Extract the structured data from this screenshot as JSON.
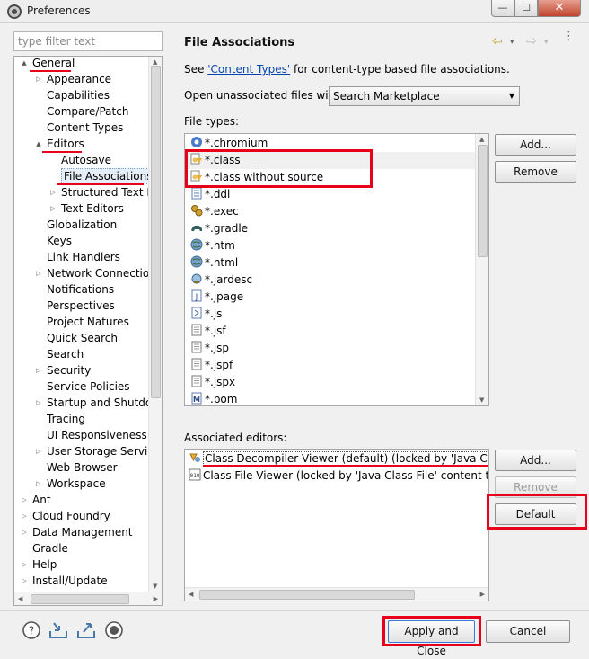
{
  "window": {
    "title": "Preferences",
    "min_glyph": "—",
    "max_glyph": "☐",
    "close_glyph": "✕"
  },
  "filter": {
    "placeholder": "type filter text"
  },
  "tree": {
    "items": [
      {
        "label": "General",
        "level": 0,
        "twisty": "▲"
      },
      {
        "label": "Appearance",
        "level": 1,
        "twisty": "▷"
      },
      {
        "label": "Capabilities",
        "level": 1,
        "twisty": ""
      },
      {
        "label": "Compare/Patch",
        "level": 1,
        "twisty": ""
      },
      {
        "label": "Content Types",
        "level": 1,
        "twisty": ""
      },
      {
        "label": "Editors",
        "level": 1,
        "twisty": "▲"
      },
      {
        "label": "Autosave",
        "level": 2,
        "twisty": ""
      },
      {
        "label": "File Associations",
        "level": 2,
        "twisty": "",
        "selected": true
      },
      {
        "label": "Structured Text Ec",
        "level": 2,
        "twisty": "▷"
      },
      {
        "label": "Text Editors",
        "level": 2,
        "twisty": "▷"
      },
      {
        "label": "Globalization",
        "level": 1,
        "twisty": ""
      },
      {
        "label": "Keys",
        "level": 1,
        "twisty": ""
      },
      {
        "label": "Link Handlers",
        "level": 1,
        "twisty": ""
      },
      {
        "label": "Network Connection",
        "level": 1,
        "twisty": "▷"
      },
      {
        "label": "Notifications",
        "level": 1,
        "twisty": ""
      },
      {
        "label": "Perspectives",
        "level": 1,
        "twisty": ""
      },
      {
        "label": "Project Natures",
        "level": 1,
        "twisty": ""
      },
      {
        "label": "Quick Search",
        "level": 1,
        "twisty": ""
      },
      {
        "label": "Search",
        "level": 1,
        "twisty": ""
      },
      {
        "label": "Security",
        "level": 1,
        "twisty": "▷"
      },
      {
        "label": "Service Policies",
        "level": 1,
        "twisty": ""
      },
      {
        "label": "Startup and Shutdow",
        "level": 1,
        "twisty": "▷"
      },
      {
        "label": "Tracing",
        "level": 1,
        "twisty": ""
      },
      {
        "label": "UI Responsiveness M",
        "level": 1,
        "twisty": ""
      },
      {
        "label": "User Storage Service",
        "level": 1,
        "twisty": "▷"
      },
      {
        "label": "Web Browser",
        "level": 1,
        "twisty": ""
      },
      {
        "label": "Workspace",
        "level": 1,
        "twisty": "▷"
      },
      {
        "label": "Ant",
        "level": 0,
        "twisty": "▷"
      },
      {
        "label": "Cloud Foundry",
        "level": 0,
        "twisty": "▷"
      },
      {
        "label": "Data Management",
        "level": 0,
        "twisty": "▷"
      },
      {
        "label": "Gradle",
        "level": 0,
        "twisty": ""
      },
      {
        "label": "Help",
        "level": 0,
        "twisty": "▷"
      },
      {
        "label": "Install/Update",
        "level": 0,
        "twisty": "▷"
      }
    ]
  },
  "main": {
    "title": "File Associations",
    "see_prefix": "See ",
    "see_link": "'Content Types'",
    "see_suffix": " for content-type based file associations.",
    "open_label": "Open unassociated files with:",
    "open_value": "Search Marketplace",
    "filetypes_label": "File types:",
    "filetypes": [
      {
        "name": "*.chromium",
        "icon": "chromium-icon"
      },
      {
        "name": "*.class",
        "icon": "class-file-icon"
      },
      {
        "name": "*.class without source",
        "icon": "class-file-icon"
      },
      {
        "name": "*.ddl",
        "icon": "ddl-icon"
      },
      {
        "name": "*.exec",
        "icon": "exec-icon"
      },
      {
        "name": "*.gradle",
        "icon": "gradle-icon"
      },
      {
        "name": "*.htm",
        "icon": "globe-icon"
      },
      {
        "name": "*.html",
        "icon": "globe-icon"
      },
      {
        "name": "*.jardesc",
        "icon": "jardesc-icon"
      },
      {
        "name": "*.jpage",
        "icon": "jpage-icon"
      },
      {
        "name": "*.js",
        "icon": "js-icon"
      },
      {
        "name": "*.jsf",
        "icon": "text-file-icon"
      },
      {
        "name": "*.jsp",
        "icon": "text-file-icon"
      },
      {
        "name": "*.jspf",
        "icon": "text-file-icon"
      },
      {
        "name": "*.jspx",
        "icon": "text-file-icon"
      },
      {
        "name": "*.pom",
        "icon": "maven-icon"
      }
    ],
    "ft_add": "Add...",
    "ft_remove": "Remove",
    "assoc_label": "Associated editors:",
    "editors": [
      {
        "name": "Class Decompiler Viewer (default) (locked by 'Java Class File' content type)",
        "icon": "decompiler-icon"
      },
      {
        "name": "Class File Viewer (locked by 'Java Class File' content type)",
        "icon": "binary-file-icon"
      }
    ],
    "ed_add": "Add...",
    "ed_remove": "Remove",
    "ed_default": "Default"
  },
  "bottom": {
    "apply_close": "Apply and Close",
    "cancel": "Cancel",
    "icons": [
      "help-icon",
      "import-icon",
      "export-icon",
      "record-icon"
    ]
  },
  "colors": {
    "annotation": "#e8001a",
    "link": "#0645ad",
    "selection": "#cfe3f7"
  }
}
